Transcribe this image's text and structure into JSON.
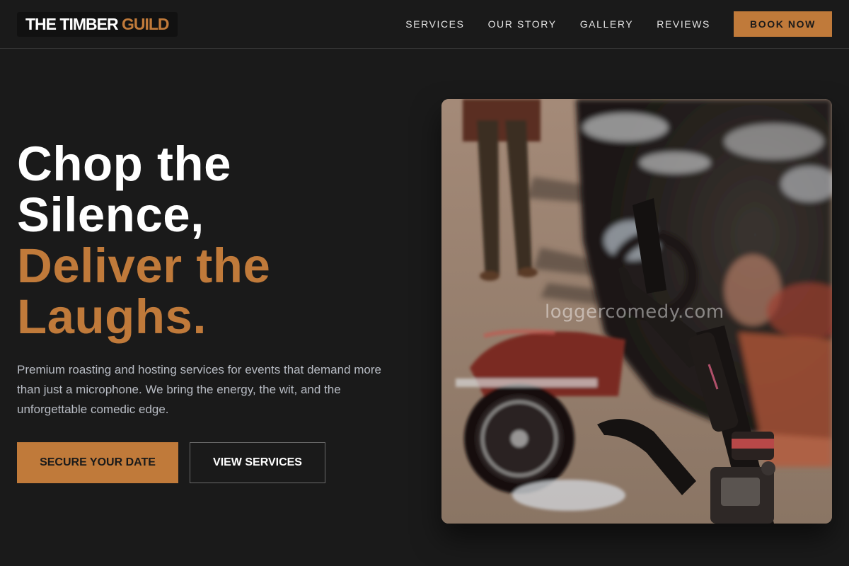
{
  "header": {
    "logo_primary": "THE TIMBER",
    "logo_accent": "GUILD",
    "nav": [
      "SERVICES",
      "OUR STORY",
      "GALLERY",
      "REVIEWS"
    ],
    "cta_label": "BOOK NOW"
  },
  "hero": {
    "title_lines": [
      "Chop the",
      "Silence,"
    ],
    "accent_lines": [
      "Deliver the",
      "Laughs."
    ],
    "description": "Premium roasting and hosting services for events that demand more than just a microphone. We bring the energy, the wit, and the unforgettable comedic edge.",
    "primary_button": "SECURE YOUR DATE",
    "secondary_button": "VIEW SERVICES",
    "image_watermark": "loggercomedy.com"
  },
  "colors": {
    "background": "#1a1a1a",
    "accent": "#c07a3a",
    "text": "#ffffff",
    "muted_text": "#b8bcc4"
  },
  "icons": [
    "motorcycle-photo"
  ]
}
